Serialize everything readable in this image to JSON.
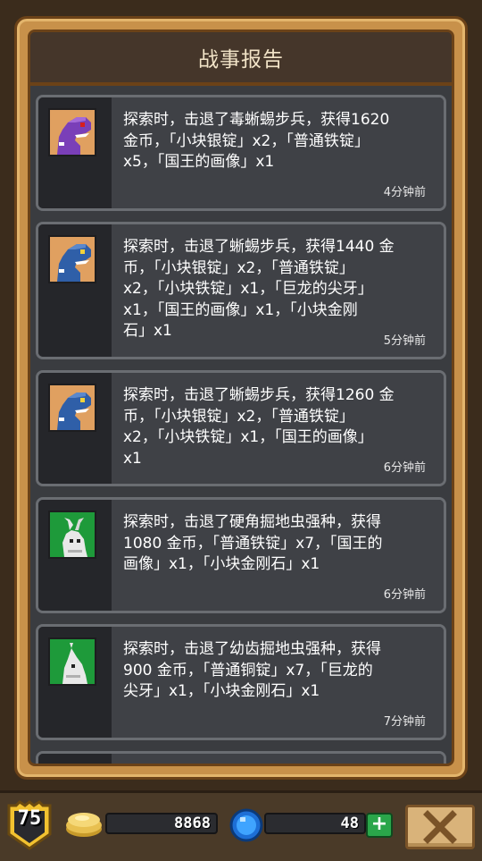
{
  "header": {
    "title": "战事报告"
  },
  "reports": [
    {
      "text": "探索时，击退了毒蜥蜴步兵，获得1620\n金币，「小块银锭」x2，「普通铁锭」\nx5，「国王的画像」x1",
      "time": "4分钟前",
      "avatar": "purple-lizard-icon"
    },
    {
      "text": "探索时，击退了蜥蜴步兵，获得1440 金\n币，「小块银锭」x2，「普通铁锭」\nx2，「小块铁锭」x1，「巨龙的尖牙」\nx1，「国王的画像」x1，「小块金刚\n石」x1",
      "time": "5分钟前",
      "avatar": "blue-lizard-icon"
    },
    {
      "text": "探索时，击退了蜥蜴步兵，获得1260 金\n币，「小块银锭」x2，「普通铁锭」\nx2，「小块铁锭」x1，「国王的画像」\nx1",
      "time": "6分钟前",
      "avatar": "blue-lizard-icon"
    },
    {
      "text": "探索时，击退了硬角掘地虫强种，获得\n1080 金币，「普通铁锭」x7，「国王的\n画像」x1，「小块金刚石」x1",
      "time": "6分钟前",
      "avatar": "white-worm-icon"
    },
    {
      "text": "探索时，击退了幼齿掘地虫强种，获得\n900 金币，「普通铜锭」x7，「巨龙的\n尖牙」x1，「小块金刚石」x1",
      "time": "7分钟前",
      "avatar": "white-worm-small-icon"
    }
  ],
  "hud": {
    "level": "75",
    "gold": "8868",
    "gems": "48",
    "add_gems_symbol": "+",
    "close_symbol": "✕"
  },
  "colors": {
    "frame": "#c8914a",
    "card_bg": "#3f4146",
    "avatar_bg_lizard": "#e0a060",
    "avatar_bg_worm": "#1e9a3a"
  }
}
